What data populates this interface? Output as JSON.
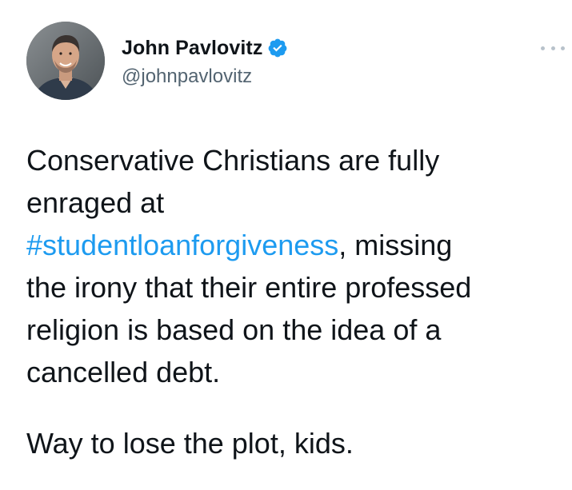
{
  "author": {
    "name": "John Pavlovitz",
    "handle": "@johnpavlovitz",
    "verified": true,
    "verified_icon": "verified-badge-icon",
    "verified_color": "#1d9bf0"
  },
  "more_icon": "more-horizontal-icon",
  "tweet": {
    "line_1": "Conservative Christians are fully",
    "line_2": "enraged at",
    "hashtag": "#studentloanforgiveness",
    "line_3_rest": ", missing",
    "line_4": "the irony that their entire professed",
    "line_5": "religion is based on the idea of a",
    "line_6": "cancelled debt.",
    "paragraph_2": "Way to lose the plot, kids."
  },
  "colors": {
    "text": "#0f1419",
    "secondary": "#536471",
    "link": "#1d9bf0"
  }
}
